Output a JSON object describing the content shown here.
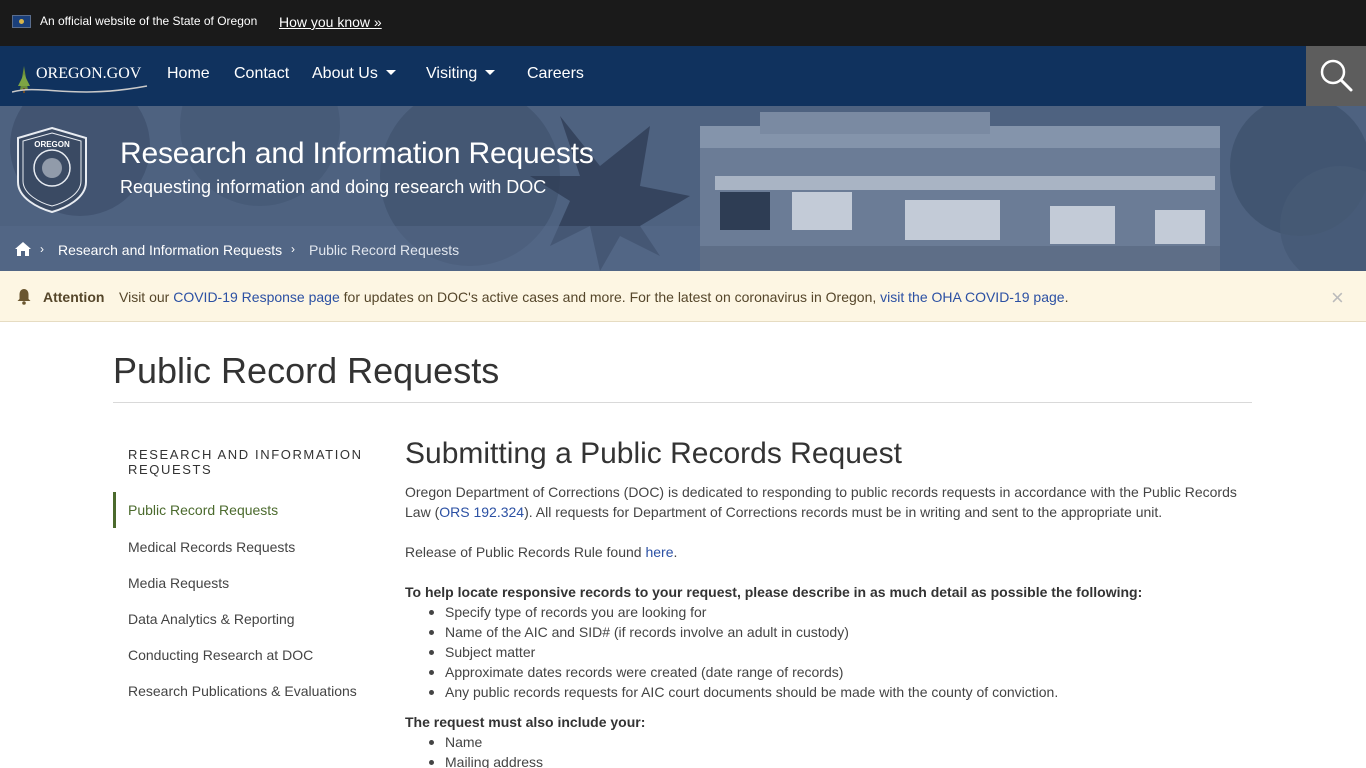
{
  "banner": {
    "official_text": "An official website of the State of Oregon",
    "how_you_know": "How you know »"
  },
  "nav": {
    "logo_text": "OREGON.GOV",
    "items": [
      {
        "label": "Home"
      },
      {
        "label": "Contact"
      },
      {
        "label": "About Us",
        "has_dropdown": true
      },
      {
        "label": "Visiting",
        "has_dropdown": true
      },
      {
        "label": "Careers"
      }
    ],
    "search_icon": "search-icon"
  },
  "hero": {
    "seal_icon": "oregon-department-of-corrections-seal",
    "seal_top_text": "OREGON",
    "title": "Research and Information Requests",
    "subtitle": "Requesting information and doing research with DOC",
    "breadcrumb": {
      "home_icon": "home-icon",
      "items": [
        "Research and Information Requests",
        "Public Record Requests"
      ]
    }
  },
  "alert": {
    "icon": "bell-icon",
    "title": "Attention",
    "text_1": "Visit our ",
    "link_1": "COVID-19 Response page",
    "text_2": " for updates on DOC's active cases and more. For the latest on coronavirus in Oregon, ",
    "link_2": "visit the OHA COVID-19 page",
    "text_3": ".",
    "close": "×"
  },
  "page_title": "Public Record Requests",
  "sidebar": {
    "heading": "RESEARCH AND INFORMATION REQUESTS",
    "items": [
      {
        "label": "Public Record Requests",
        "active": true
      },
      {
        "label": "Medical Records Requests"
      },
      {
        "label": "Media Requests"
      },
      {
        "label": "Data Analytics & Reporting"
      },
      {
        "label": "Conducting Research at DOC"
      },
      {
        "label": "Research Publications & Evaluations"
      }
    ]
  },
  "main": {
    "heading": "Submitting a Public Records Request",
    "intro_1": "Oregon Department of Corrections (DOC) is dedicated to responding to public records requests in accordance with the Public Records Law (",
    "intro_link": "ORS 192.324",
    "intro_2": "). All requests for Department of Corrections records must be in writing and sent to the appropriate unit.",
    "rule_text": "Release of Public Records Rule found ",
    "rule_link": "here",
    "rule_end": ".",
    "locate_heading": "To help locate responsive records to your request, please describe in as much detail as possible the following:",
    "locate_items": [
      "Specify type of records you are looking for",
      "Name of the AIC and SID# (if records involve an adult in custody)",
      "Subject matter",
      "Approximate dates records were created (date range of records)",
      "Any public records requests for AIC court documents should be made with the county of conviction."
    ],
    "include_heading": "The request must also include your:",
    "include_items": [
      "Name",
      "Mailing address"
    ]
  }
}
